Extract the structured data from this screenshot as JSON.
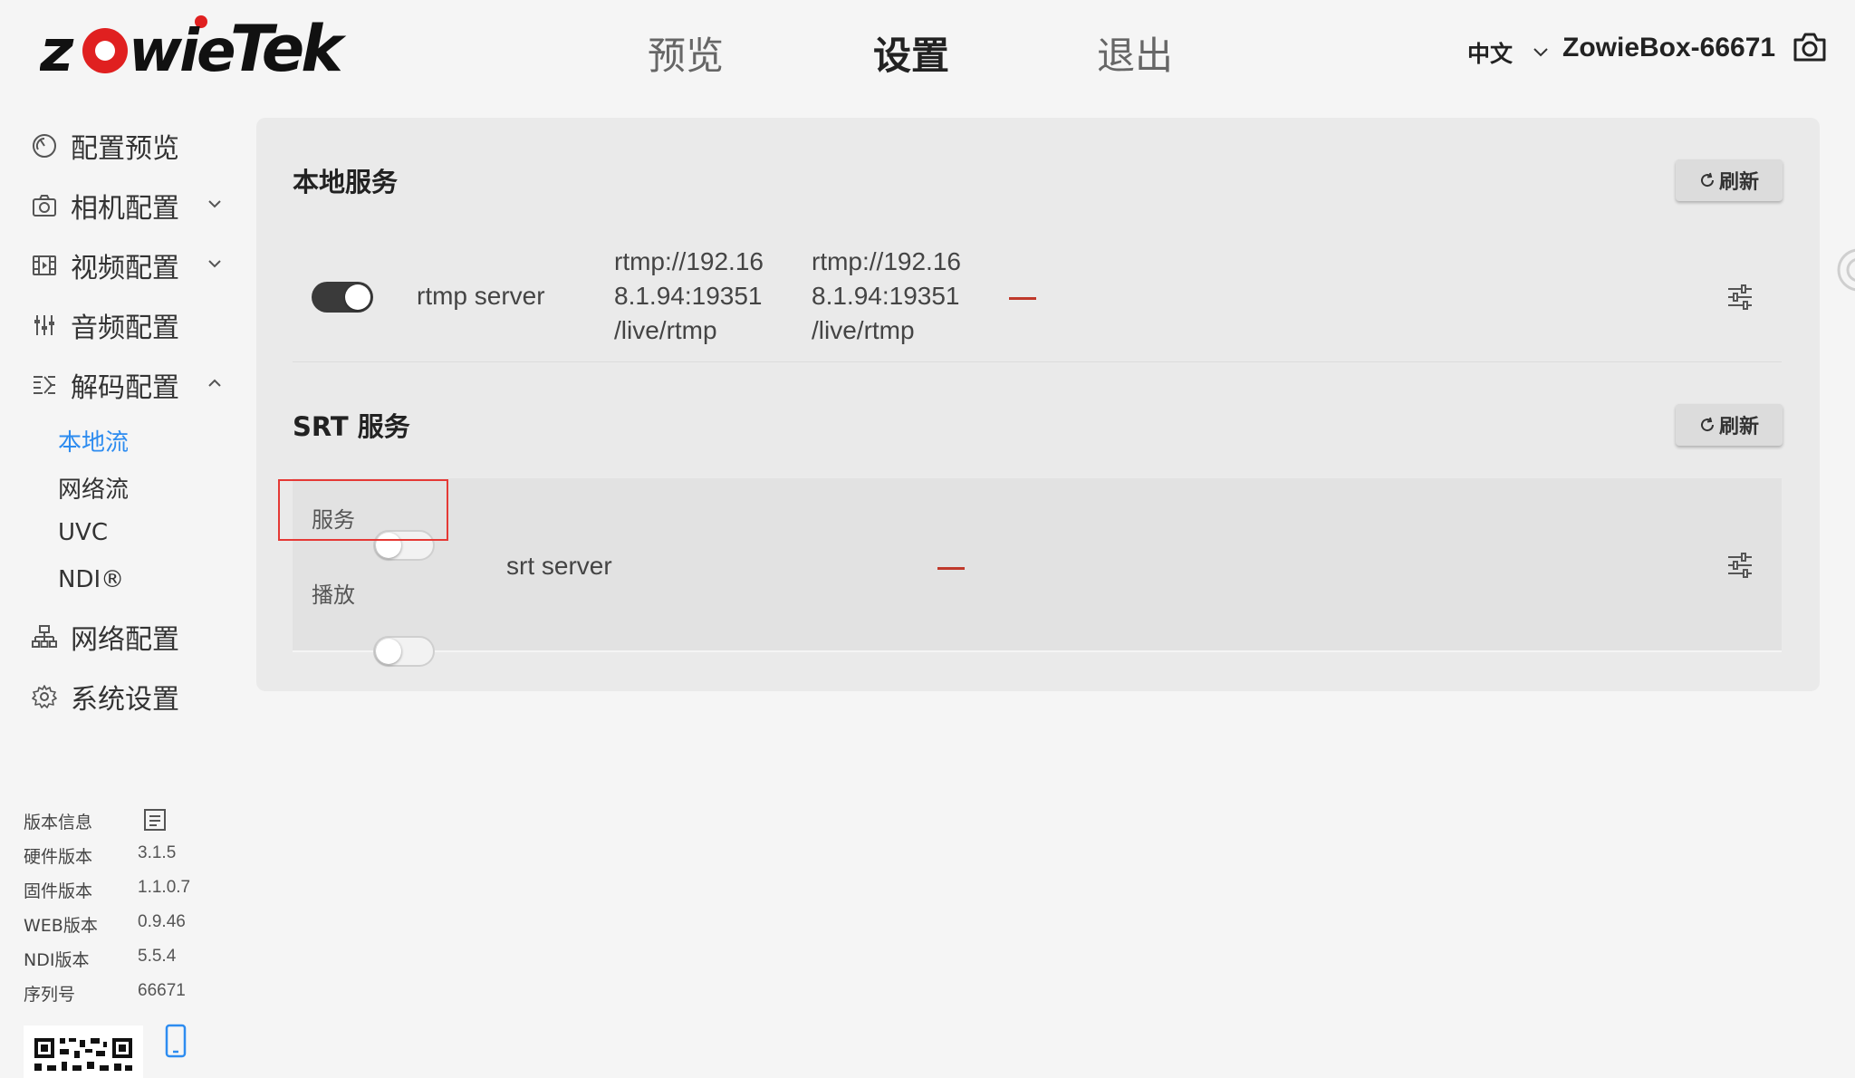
{
  "header": {
    "brand": "zowieTek",
    "nav": [
      {
        "label": "预览"
      },
      {
        "label": "设置"
      },
      {
        "label": "退出"
      }
    ],
    "language": "中文",
    "device_name": "ZowieBox-66671"
  },
  "sidebar": {
    "items": [
      {
        "label": "配置预览",
        "icon": "dashboard-icon"
      },
      {
        "label": "相机配置",
        "icon": "camera-icon"
      },
      {
        "label": "视频配置",
        "icon": "film-icon"
      },
      {
        "label": "音频配置",
        "icon": "equalizer-icon"
      },
      {
        "label": "解码配置",
        "icon": "decode-icon"
      },
      {
        "label": "网络配置",
        "icon": "network-icon"
      },
      {
        "label": "系统设置",
        "icon": "gear-icon"
      }
    ],
    "decode_sub": [
      {
        "label": "本地流",
        "active": true
      },
      {
        "label": "网络流"
      },
      {
        "label": "UVC"
      },
      {
        "label": "NDI®"
      }
    ],
    "version": {
      "title": "版本信息",
      "rows": [
        {
          "label": "硬件版本",
          "value": "3.1.5"
        },
        {
          "label": "固件版本",
          "value": "1.1.0.7"
        },
        {
          "label": "WEB版本",
          "value": "0.9.46"
        },
        {
          "label": "NDI版本",
          "value": "5.5.4"
        },
        {
          "label": "序列号",
          "value": "66671"
        }
      ]
    }
  },
  "main": {
    "local": {
      "title": "本地服务",
      "refresh": "刷新",
      "row": {
        "enabled": true,
        "name": "rtmp server",
        "url1": [
          "rtmp://192.16",
          "8.1.94:19351",
          "/live/rtmp"
        ],
        "url2": [
          "rtmp://192.16",
          "8.1.94:19351",
          "/live/rtmp"
        ]
      }
    },
    "srt": {
      "title": "SRT 服务",
      "refresh": "刷新",
      "service_label": "服务",
      "play_label": "播放",
      "service_on": false,
      "play_on": false,
      "name": "srt server"
    }
  },
  "colors": {
    "accent": "#2d8cf0",
    "status_dash": "#c0392b",
    "highlight": "#e53935"
  }
}
